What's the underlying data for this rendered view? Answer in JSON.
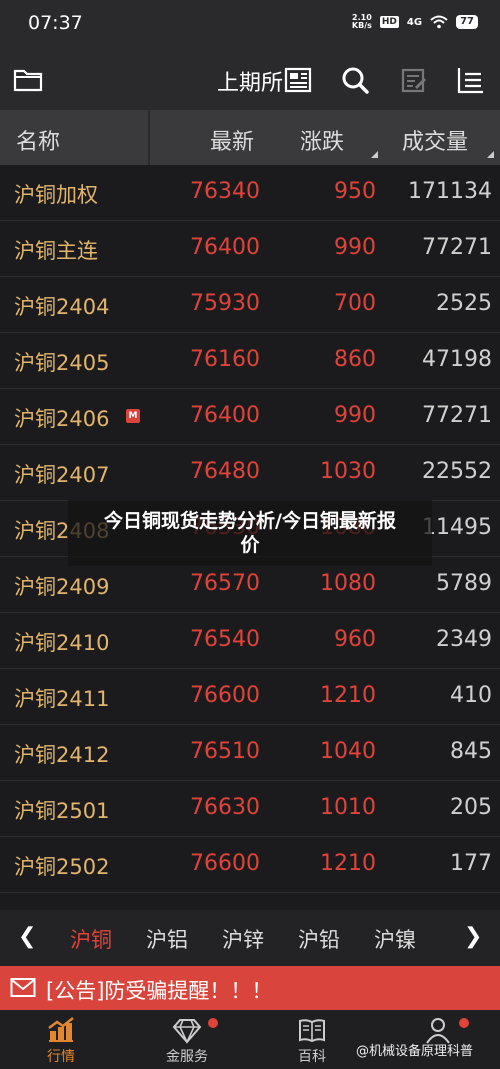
{
  "status": {
    "time": "07:37",
    "speed_value": "2.10",
    "speed_unit": "KB/s",
    "hd": "HD",
    "network": "4G",
    "battery": "77"
  },
  "appbar": {
    "title": "上期所"
  },
  "columns": {
    "name": "名称",
    "last": "最新",
    "change": "涨跌",
    "volume": "成交量"
  },
  "rows": [
    {
      "name": "沪铜加权",
      "last": "76340",
      "change": "950",
      "volume": "171134"
    },
    {
      "name": "沪铜主连",
      "last": "76400",
      "change": "990",
      "volume": "77271"
    },
    {
      "name": "沪铜2404",
      "last": "75930",
      "change": "700",
      "volume": "2525"
    },
    {
      "name": "沪铜2405",
      "last": "76160",
      "change": "860",
      "volume": "47198"
    },
    {
      "name": "沪铜2406",
      "badge": "M",
      "last": "76400",
      "change": "990",
      "volume": "77271"
    },
    {
      "name": "沪铜2407",
      "last": "76480",
      "change": "1030",
      "volume": "22552"
    },
    {
      "name": "沪铜2408",
      "last": "76530",
      "change": "1080",
      "volume": "11495"
    },
    {
      "name": "沪铜2409",
      "last": "76570",
      "change": "1080",
      "volume": "5789"
    },
    {
      "name": "沪铜2410",
      "last": "76540",
      "change": "960",
      "volume": "2349"
    },
    {
      "name": "沪铜2411",
      "last": "76600",
      "change": "1210",
      "volume": "410"
    },
    {
      "name": "沪铜2412",
      "last": "76510",
      "change": "1040",
      "volume": "845"
    },
    {
      "name": "沪铜2501",
      "last": "76630",
      "change": "1010",
      "volume": "205"
    },
    {
      "name": "沪铜2502",
      "last": "76600",
      "change": "1210",
      "volume": "177"
    }
  ],
  "overlay": {
    "headline": "今日铜现货走势分析/今日铜最新报价"
  },
  "tabs": [
    "沪铜",
    "沪铝",
    "沪锌",
    "沪铅",
    "沪镍"
  ],
  "notice": {
    "text": "[公告]防受骗提醒！！！"
  },
  "nav": {
    "market": "行情",
    "gold": "金服务",
    "wiki": "百科"
  },
  "watermark": "@机械设备原理科普",
  "colors": {
    "accent": "#e0433a",
    "name": "#e2b56d",
    "active_nav": "#e2862f"
  }
}
